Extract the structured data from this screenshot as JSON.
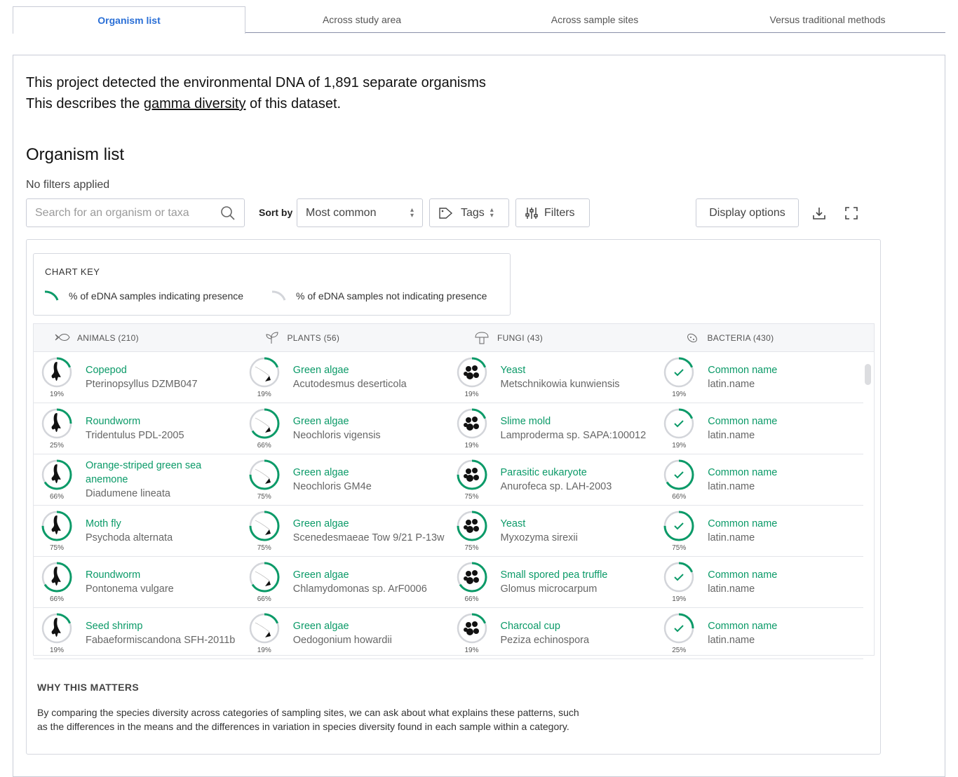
{
  "tabs": [
    "Organism list",
    "Across study area",
    "Across sample sites",
    "Versus traditional methods"
  ],
  "intro": {
    "line1": "This project detected the environmental DNA of 1,891 separate organisms",
    "line2_pre": "This describes the ",
    "line2_link": "gamma diversity",
    "line2_post": " of this dataset."
  },
  "heading": "Organism list",
  "filters_status": "No filters applied",
  "controls": {
    "search_placeholder": "Search for an organism or taxa",
    "sort_label": "Sort by",
    "sort_value": "Most common",
    "tags": "Tags",
    "filters": "Filters",
    "display": "Display options"
  },
  "chart_key": {
    "title": "CHART KEY",
    "present": "% of eDNA samples indicating presence",
    "absent": "% of eDNA samples not indicating presence"
  },
  "colors": {
    "accent": "#0b9a68",
    "ring": "#d3d5da"
  },
  "categories": [
    {
      "label": "ANIMALS (210)",
      "icon": "fish-icon"
    },
    {
      "label": "PLANTS (56)",
      "icon": "leaf-icon"
    },
    {
      "label": "FUNGI (43)",
      "icon": "mushroom-icon"
    },
    {
      "label": "BACTERIA (430)",
      "icon": "bacteria-icon"
    }
  ],
  "rows": [
    [
      {
        "name": "Copepod",
        "latin": "Pterinopsyllus DZMB047",
        "pct": 19
      },
      {
        "name": "Green algae",
        "latin": "Acutodesmus deserticola",
        "pct": 19
      },
      {
        "name": "Yeast",
        "latin": "Metschnikowia kunwiensis",
        "pct": 19
      },
      {
        "name": "Common name",
        "latin": "latin.name",
        "pct": 19
      }
    ],
    [
      {
        "name": "Roundworm",
        "latin": "Tridentulus PDL-2005",
        "pct": 25
      },
      {
        "name": "Green algae",
        "latin": "Neochloris vigensis",
        "pct": 66
      },
      {
        "name": "Slime mold",
        "latin": "Lamproderma sp. SAPA:100012",
        "pct": 19
      },
      {
        "name": "Common name",
        "latin": "latin.name",
        "pct": 19
      }
    ],
    [
      {
        "name": "Orange-striped green sea anemone",
        "latin": "Diadumene lineata",
        "pct": 66
      },
      {
        "name": "Green algae",
        "latin": "Neochloris GM4e",
        "pct": 75
      },
      {
        "name": "Parasitic eukaryote",
        "latin": "Anurofeca sp. LAH-2003",
        "pct": 75
      },
      {
        "name": "Common name",
        "latin": "latin.name",
        "pct": 66
      }
    ],
    [
      {
        "name": "Moth fly",
        "latin": "Psychoda alternata",
        "pct": 75
      },
      {
        "name": "Green algae",
        "latin": "Scenedesmaeae Tow 9/21 P-13w",
        "pct": 75
      },
      {
        "name": "Yeast",
        "latin": "Myxozyma sirexii",
        "pct": 75
      },
      {
        "name": "Common name",
        "latin": "latin.name",
        "pct": 75
      }
    ],
    [
      {
        "name": "Roundworm",
        "latin": "Pontonema vulgare",
        "pct": 66
      },
      {
        "name": "Green algae",
        "latin": "Chlamydomonas sp. ArF0006",
        "pct": 66
      },
      {
        "name": "Small spored pea truffle",
        "latin": "Glomus microcarpum",
        "pct": 66
      },
      {
        "name": "Common name",
        "latin": "latin.name",
        "pct": 19
      }
    ],
    [
      {
        "name": "Seed shrimp",
        "latin": "Fabaeformiscandona SFH-2011b",
        "pct": 19
      },
      {
        "name": "Green algae",
        "latin": "Oedogonium howardii",
        "pct": 19
      },
      {
        "name": "Charcoal cup",
        "latin": "Peziza echinospora",
        "pct": 19
      },
      {
        "name": "Common name",
        "latin": "latin.name",
        "pct": 25
      }
    ]
  ],
  "why": {
    "title": "WHY THIS MATTERS",
    "text": "By comparing the species diversity across categories of sampling sites, we can ask about what explains these patterns, such as the differences in the means and the differences in variation in species diversity found in each sample within a category."
  }
}
